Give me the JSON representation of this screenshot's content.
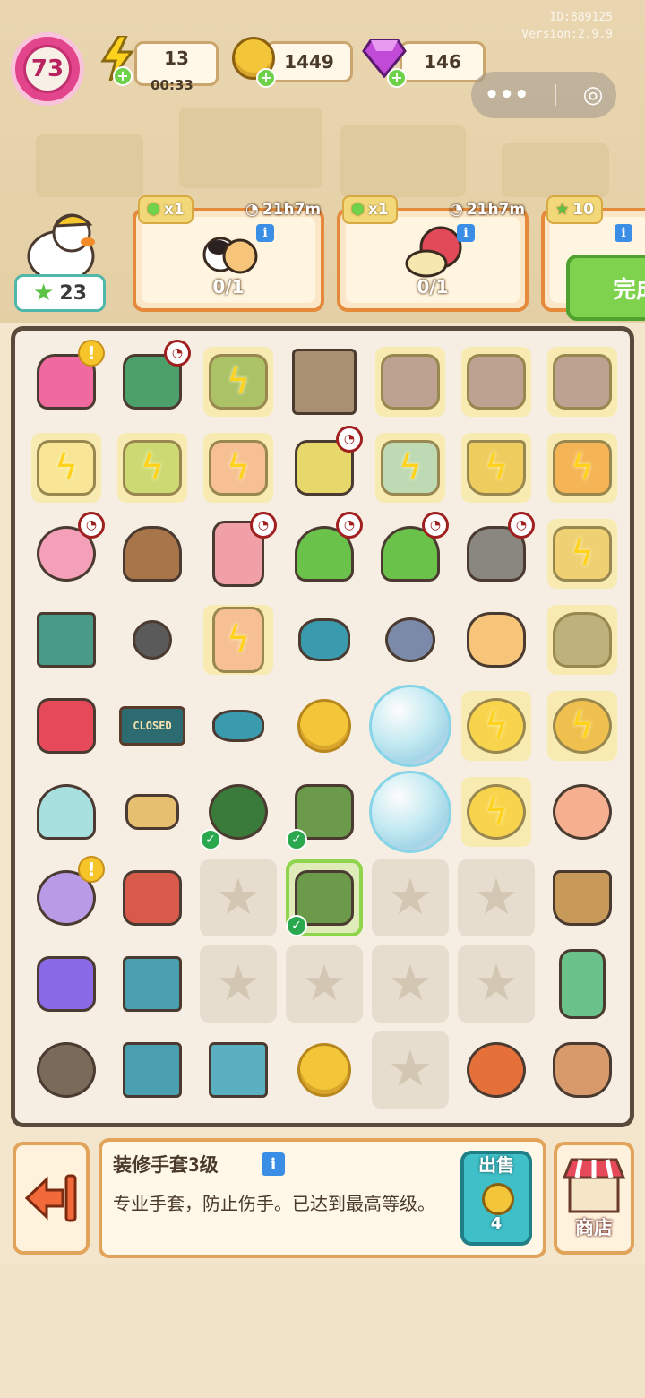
{
  "header": {
    "id_text": "ID:889125",
    "version_text": "Version:2.9.9",
    "level": "73",
    "energy": {
      "value": "13",
      "timer": "00:33"
    },
    "coins": {
      "value": "1449"
    },
    "gems": {
      "value": "146"
    }
  },
  "profile": {
    "stars": "23"
  },
  "orders": [
    {
      "reward_label": "x1",
      "timer": "21h7m",
      "progress": "0/1"
    },
    {
      "reward_label": "x1",
      "timer": "21h7m",
      "progress": "0/1"
    },
    {
      "reward_label": "10"
    }
  ],
  "complete_button": {
    "label": "完成"
  },
  "board": {
    "closed_sign_text": "CLOSED"
  },
  "info_panel": {
    "title": "装修手套3级",
    "description": "专业手套，防止伤手。已达到最高等级。"
  },
  "sell_button": {
    "label": "出售",
    "value": "4"
  },
  "shop_button": {
    "label": "商店"
  },
  "colors": {
    "accent_orange": "#e58a3a",
    "level_pink": "#e2458c",
    "complete_green": "#7ed24d",
    "sell_teal": "#3fc0c8"
  }
}
